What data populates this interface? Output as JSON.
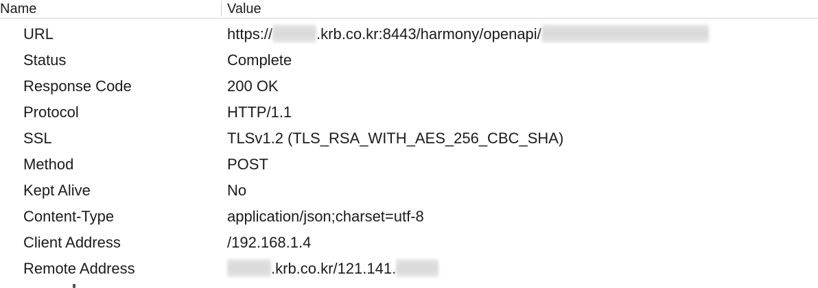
{
  "header": {
    "name_label": "Name",
    "value_label": "Value"
  },
  "rows": [
    {
      "name": "URL",
      "value_prefix": "https://",
      "value_middle": ".krb.co.kr:8443/harmony/openapi/",
      "value_suffix": ""
    },
    {
      "name": "Status",
      "value": "Complete"
    },
    {
      "name": "Response Code",
      "value": "200 OK"
    },
    {
      "name": "Protocol",
      "value": "HTTP/1.1"
    },
    {
      "name": "SSL",
      "value": "TLSv1.2 (TLS_RSA_WITH_AES_256_CBC_SHA)"
    },
    {
      "name": "Method",
      "value": "POST"
    },
    {
      "name": "Kept Alive",
      "value": "No"
    },
    {
      "name": "Content-Type",
      "value": "application/json;charset=utf-8"
    },
    {
      "name": "Client Address",
      "value": "/192.168.1.4"
    },
    {
      "name": "Remote Address",
      "value_prefix": "",
      "value_middle": ".krb.co.kr/121.141.",
      "value_suffix": ""
    }
  ]
}
